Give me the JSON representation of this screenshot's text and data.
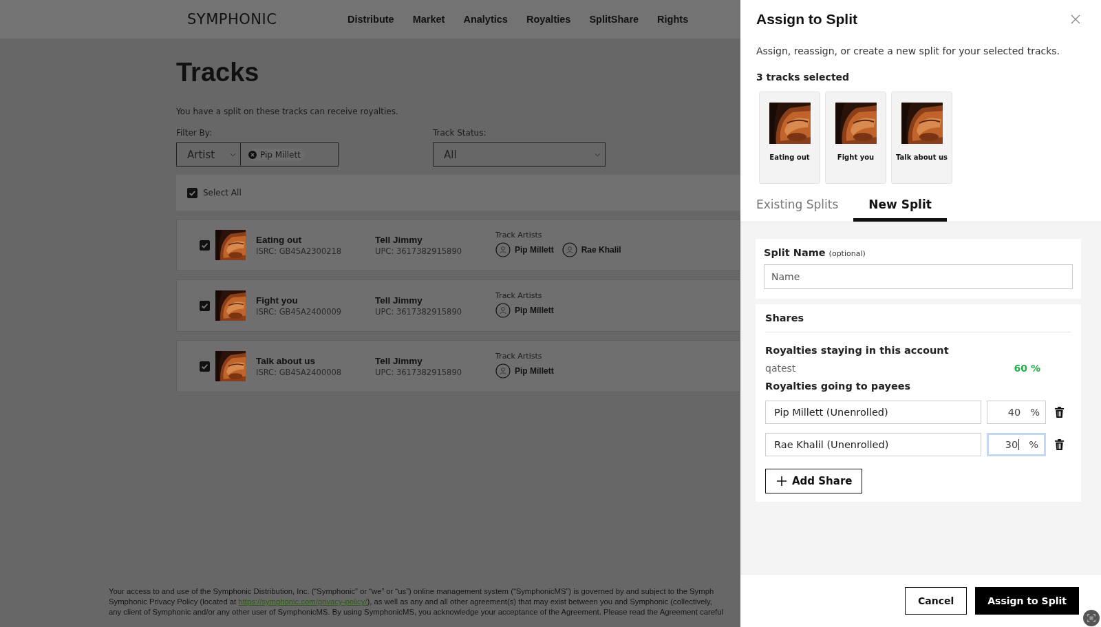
{
  "header": {
    "logo": "SYMPHONIC",
    "nav": [
      {
        "label": "Distribute"
      },
      {
        "label": "Market"
      },
      {
        "label": "Analytics"
      },
      {
        "label": "Royalties"
      },
      {
        "label": "SplitShare"
      },
      {
        "label": "Rights"
      }
    ]
  },
  "page": {
    "title": "Tracks",
    "description": "You have a split on these tracks can receive royalties.",
    "filter": {
      "label": "Filter By:",
      "type_value": "Artist",
      "chip": "Pip Millett"
    },
    "status": {
      "label": "Track Status:",
      "value": "All"
    },
    "select_all": {
      "label": "Select All",
      "checked": true
    },
    "tracks": [
      {
        "title": "Eating out",
        "isrc": "ISRC: GB45A2300218",
        "release": "Tell Jimmy",
        "upc": "UPC: 3617382915890",
        "artists_label": "Track Artists",
        "artists": [
          "Pip Millett",
          "Rae Khalil"
        ],
        "checked": true,
        "image": {
          "kind": "picture"
        }
      },
      {
        "title": "Fight you",
        "isrc": "ISRC: GB45A2400009",
        "release": "Tell Jimmy",
        "upc": "UPC: 3617382915890",
        "artists_label": "Track Artists",
        "artists": [
          "Pip Millett"
        ],
        "checked": true,
        "image": {
          "kind": "picture"
        }
      },
      {
        "title": "Talk about us",
        "isrc": "ISRC: GB45A2400008",
        "release": "Tell Jimmy",
        "upc": "UPC: 3617382915890",
        "artists_label": "Track Artists",
        "artists": [
          "Pip Millett"
        ],
        "checked": true,
        "image": {
          "kind": "picture"
        }
      }
    ],
    "legal": [
      {
        "text": "Your access to and use of the Symphonic Distribution, Inc. (“Symphonic” or “we” or “us”) online management system (“SymphonicMS”) is governed by and subject to the Symph"
      },
      {
        "text": "Symphonic Privacy Policy (located at ",
        "link": "https://symphonic.com/privacy-policy/",
        "after": "), as well as any and all other agreement(s) that may exist between you and Symphonic (collectively,"
      },
      {
        "text": "any client of Symphonic and/or any other user of SymphonicMS. By using SymphonicMS, you acknowledge your acceptance of the Agreement. Please read the Agreement careful"
      }
    ]
  },
  "panel": {
    "title": "Assign to Split",
    "subtitle": "Assign, reassign, or create a new split for your selected tracks.",
    "count": "3 tracks selected",
    "selected_tracks": [
      {
        "title": "Eating out",
        "image": {
          "kind": "picture"
        }
      },
      {
        "title": "Fight you",
        "image": {
          "kind": "picture"
        }
      },
      {
        "title": "Talk about us",
        "image": {
          "kind": "picture"
        }
      }
    ],
    "tabs": [
      {
        "label": "Existing Splits",
        "selected": false
      },
      {
        "label": "New Split",
        "selected": true
      }
    ],
    "split_name": {
      "label": "Split Name",
      "hint": "(optional)",
      "placeholder": "Name"
    },
    "shares": {
      "title": "Shares",
      "staying_label": "Royalties staying in this account",
      "account": "qatest",
      "account_share": "60 %",
      "payees_label": "Royalties going to payees",
      "payees": [
        {
          "name": "Pip Millett (Unenrolled)",
          "percent": "40",
          "unit": "%",
          "focused": false
        },
        {
          "name": "Rae Khalil (Unenrolled)",
          "percent": "30",
          "unit": "%",
          "focused": true
        }
      ],
      "add_button": "Add Share"
    },
    "buttons": {
      "cancel": "Cancel",
      "confirm": "Assign to Split"
    }
  }
}
